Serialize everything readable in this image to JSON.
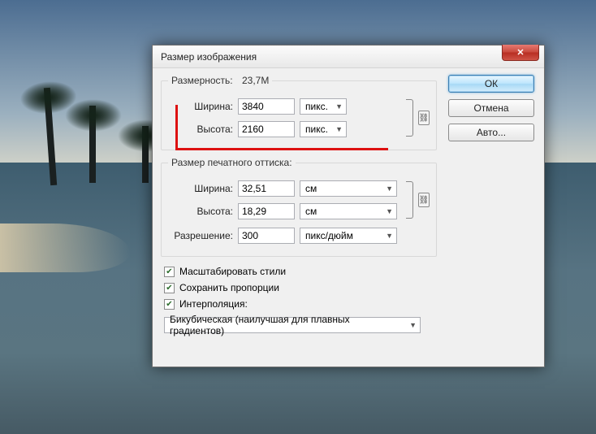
{
  "dialog": {
    "title": "Размер изображения",
    "close_glyph": "✕",
    "dimensions": {
      "legend": "Размерность:",
      "value": "23,7M",
      "width_label": "Ширина:",
      "width_value": "3840",
      "height_label": "Высота:",
      "height_value": "2160",
      "unit": "пикс."
    },
    "print": {
      "legend": "Размер печатного оттиска:",
      "width_label": "Ширина:",
      "width_value": "32,51",
      "height_label": "Высота:",
      "height_value": "18,29",
      "unit": "см",
      "res_label": "Разрешение:",
      "res_value": "300",
      "res_unit": "пикс/дюйм"
    },
    "checks": {
      "scale_styles": "Масштабировать стили",
      "constrain": "Сохранить пропорции",
      "interpolation": "Интерполяция:"
    },
    "interp_method": "Бикубическая (наилучшая для плавных градиентов)",
    "buttons": {
      "ok": "ОК",
      "cancel": "Отмена",
      "auto": "Авто..."
    },
    "link_glyph": "⛓"
  }
}
